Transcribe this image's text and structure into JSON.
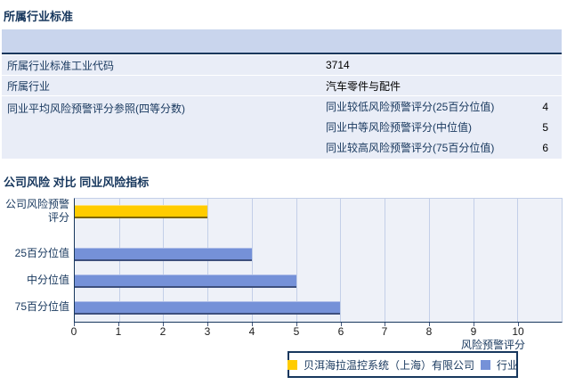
{
  "titles": {
    "industry_section": "所属行业标准",
    "risk_section": "公司风险 对比 同业风险指标"
  },
  "table": {
    "rows": [
      {
        "label": "所属行业标准工业代码",
        "value": "3714"
      },
      {
        "label": "所属行业",
        "value": "汽车零件与配件"
      },
      {
        "label": "同业平均风险预警评分参照(四等分数)",
        "sub_rows": [
          {
            "label": "同业较低风险预警评分(25百分位值)",
            "value": "4"
          },
          {
            "label": "同业中等风险预警评分(中位值)",
            "value": "5"
          },
          {
            "label": "同业较高风险预警评分(75百分位值)",
            "value": "6"
          }
        ]
      }
    ]
  },
  "chart_data": {
    "type": "bar",
    "orientation": "horizontal",
    "title": "公司风险 对比 同业风险指标",
    "categories": [
      "公司风险预警评分",
      "25百分位值",
      "中分位值",
      "75百分位值"
    ],
    "category_labels": [
      "公司风险预警\n评分",
      "25百分位值",
      "中分位值",
      "75百分位值"
    ],
    "series": [
      {
        "name": "贝洱海拉温控系统（上海）有限公司",
        "color": "#ffcc00",
        "values": [
          3,
          null,
          null,
          null
        ]
      },
      {
        "name": "行业",
        "color": "#7591d8",
        "values": [
          null,
          4,
          5,
          6
        ]
      }
    ],
    "xlabel": "风险预警评分",
    "xlim": [
      0,
      11
    ],
    "x_ticks": [
      "0",
      "1",
      "2",
      "3",
      "4",
      "5",
      "6",
      "7",
      "8",
      "9",
      "10"
    ],
    "grid": true,
    "legend_position": "bottom"
  },
  "colors": {
    "accent_navy": "#17375d",
    "table_header_bg": "#c9d5ed",
    "table_row_bg": "#e9edf7",
    "plot_bg": "#eef1f8",
    "gridline": "#c3cfe8",
    "company_bar": "#ffcc00",
    "industry_bar": "#7591d8"
  }
}
